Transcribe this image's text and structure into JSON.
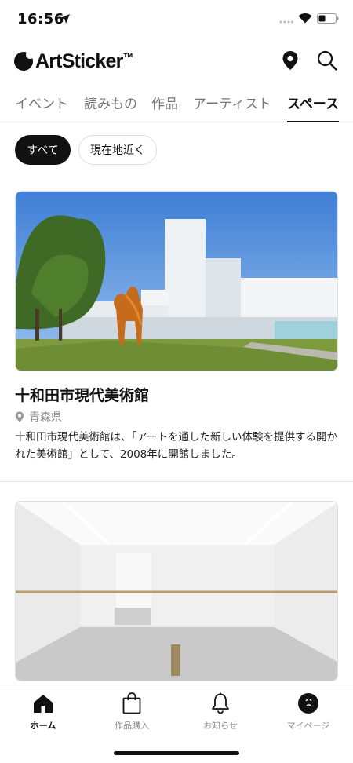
{
  "status_bar": {
    "time": "16:56"
  },
  "header": {
    "logo_text": "ArtSticker",
    "logo_tm": "TM"
  },
  "tabs": [
    {
      "label": "イベント"
    },
    {
      "label": "読みもの"
    },
    {
      "label": "作品"
    },
    {
      "label": "アーティスト"
    },
    {
      "label": "スペース",
      "active": true
    }
  ],
  "filters": {
    "all": "すべて",
    "nearby": "現在地近く"
  },
  "spaces": [
    {
      "title": "十和田市現代美術館",
      "prefecture": "青森県",
      "description": "十和田市現代美術館は、「アートを通した新しい体験を提供する開かれた美術館」として、2008年に開館しました。"
    }
  ],
  "bottom_nav": [
    {
      "label": "ホーム",
      "icon": "home-icon",
      "active": true
    },
    {
      "label": "作品購入",
      "icon": "shopping-bag-icon"
    },
    {
      "label": "お知らせ",
      "icon": "bell-icon"
    },
    {
      "label": "マイページ",
      "icon": "profile-icon"
    }
  ]
}
